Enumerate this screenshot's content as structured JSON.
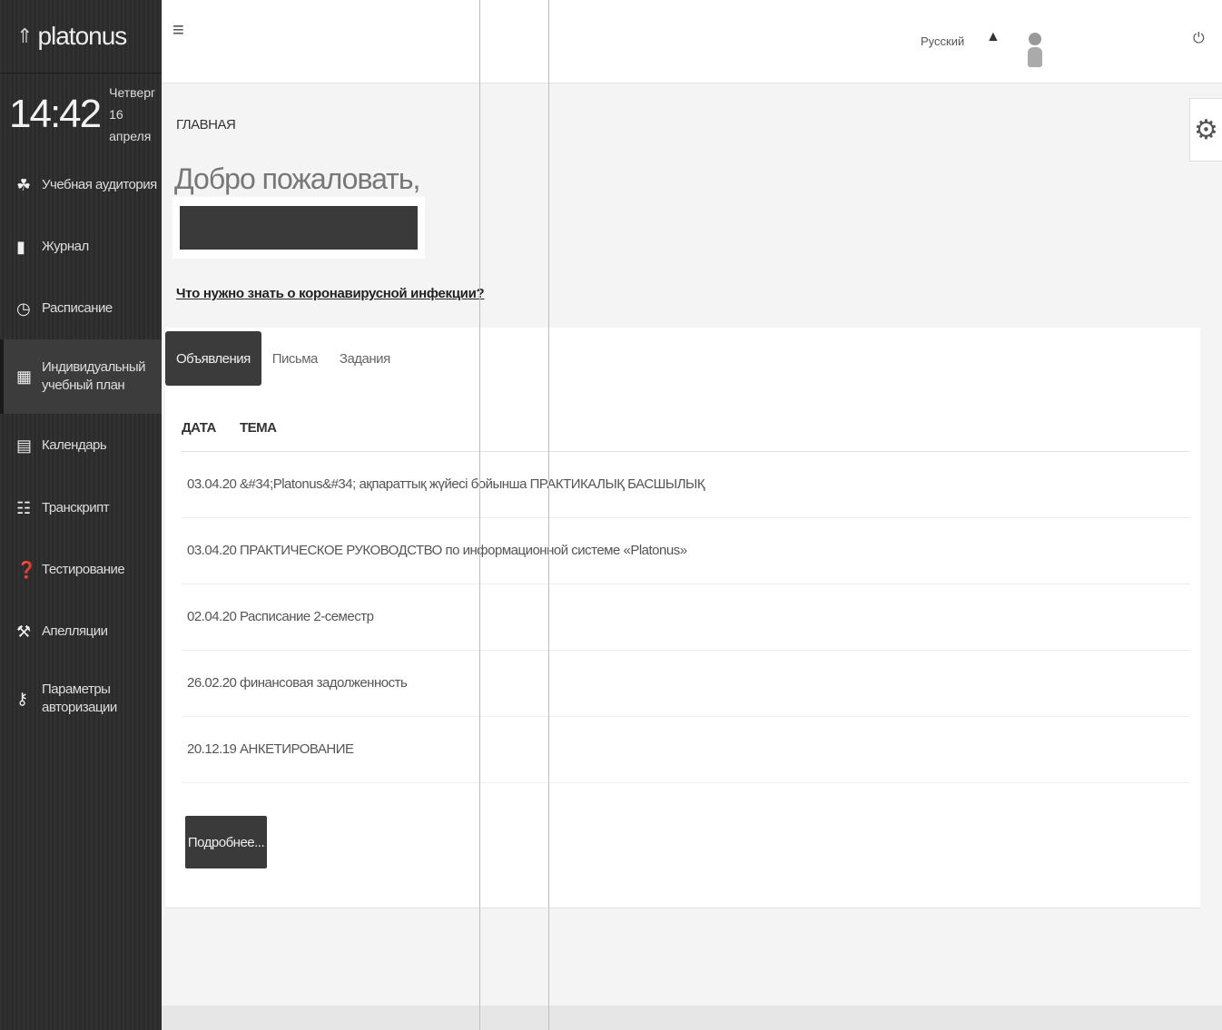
{
  "app": {
    "logo": "platonus"
  },
  "clock": {
    "time": "14:42",
    "weekday": "Четверг",
    "date": "16 апреля"
  },
  "sidebar": {
    "items": [
      {
        "label": "Учебная аудитория",
        "icon": "people-icon"
      },
      {
        "label": "Журнал",
        "icon": "book-icon"
      },
      {
        "label": "Расписание",
        "icon": "clock-icon"
      },
      {
        "label": "Индивидуальный учебный план",
        "icon": "grid-icon"
      },
      {
        "label": "Календарь",
        "icon": "calendar-icon"
      },
      {
        "label": "Транскрипт",
        "icon": "list-icon"
      },
      {
        "label": "Тестирование",
        "icon": "question-icon"
      },
      {
        "label": "Апелляции",
        "icon": "gavel-icon"
      },
      {
        "label": "Параметры авторизации",
        "icon": "key-icon"
      }
    ]
  },
  "topbar": {
    "language": "Русский"
  },
  "main": {
    "breadcrumb": "ГЛАВНАЯ",
    "welcome": "Добро пожаловать,",
    "covid_link": "Что нужно знать о коронавирусной инфекции?",
    "tabs": [
      {
        "label": "Объявления",
        "active": true
      },
      {
        "label": "Письма",
        "active": false
      },
      {
        "label": "Задания",
        "active": false
      }
    ],
    "table": {
      "headers": {
        "date": "ДАТА",
        "topic": "ТЕМА"
      },
      "rows": [
        {
          "date": "03.04.20",
          "topic": "&#34;Platonus&#34; ақпараттық жүйесі бойынша ПРАКТИКАЛЫҚ БАСШЫЛЫҚ"
        },
        {
          "date": "03.04.20",
          "topic": "ПРАКТИЧЕСКОЕ РУКОВОДСТВО по информационной системе «Platonus»"
        },
        {
          "date": "02.04.20",
          "topic": "Расписание 2-семестр"
        },
        {
          "date": "26.02.20",
          "topic": "финансовая задолженность"
        },
        {
          "date": "20.12.19",
          "topic": "АНКЕТИРОВАНИЕ"
        }
      ]
    },
    "more_button": "Подробнее..."
  },
  "colors": {
    "sidebar_bg": "#2b2b2b",
    "active_tab": "#3b3b3b",
    "page_bg": "#f4f4f4"
  }
}
